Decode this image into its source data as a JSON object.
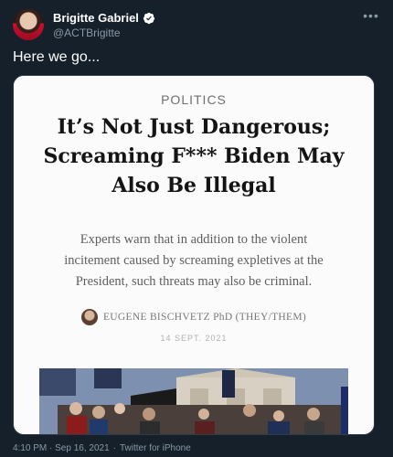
{
  "tweet": {
    "display_name": "Brigitte Gabriel",
    "handle": "@ACTBrigitte",
    "verified_icon": "verified-badge-icon",
    "more_icon": "more-options-icon",
    "text": "Here we go...",
    "timestamp": "4:10 PM · Sep 16, 2021",
    "separator": "·",
    "source": "Twitter for iPhone"
  },
  "article": {
    "section": "POLITICS",
    "headline_line1": "It’s Not Just Dangerous;",
    "headline_line2": "Screaming F*** Biden May",
    "headline_line3": "Also Be Illegal",
    "dek_line1": "Experts warn that in addition to the violent",
    "dek_line2": "incitement caused by screaming expletives at the",
    "dek_line3": "President, such threats may also be criminal.",
    "author": "EUGENE BISCHVETZ PhD (THEY/THEM)",
    "date": "14 SEPT. 2021"
  },
  "colors": {
    "background": "#15202b",
    "verified": "#1d9bf0",
    "muted": "#8899a6"
  }
}
